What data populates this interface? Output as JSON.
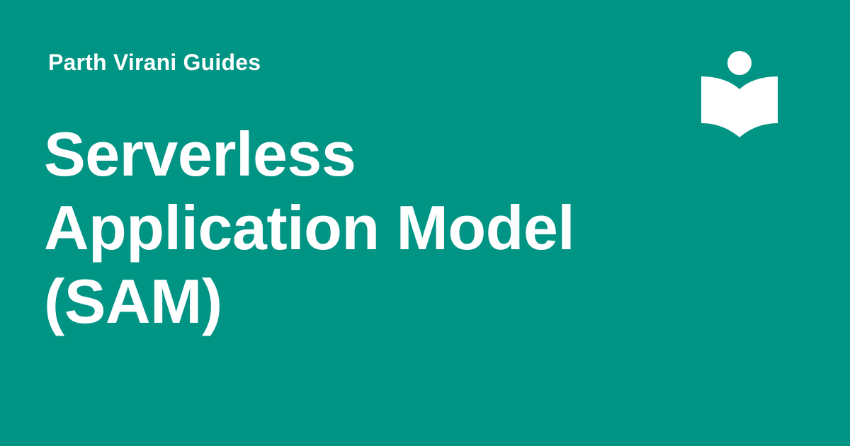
{
  "brand": {
    "name": "Parth Virani Guides",
    "logo_icon": "open-book-reader-icon",
    "color": "#ffffff"
  },
  "title": {
    "lines": [
      "Serverless",
      "Application Model",
      "(SAM)"
    ]
  },
  "colors": {
    "background": "#009484",
    "text": "#ffffff"
  }
}
